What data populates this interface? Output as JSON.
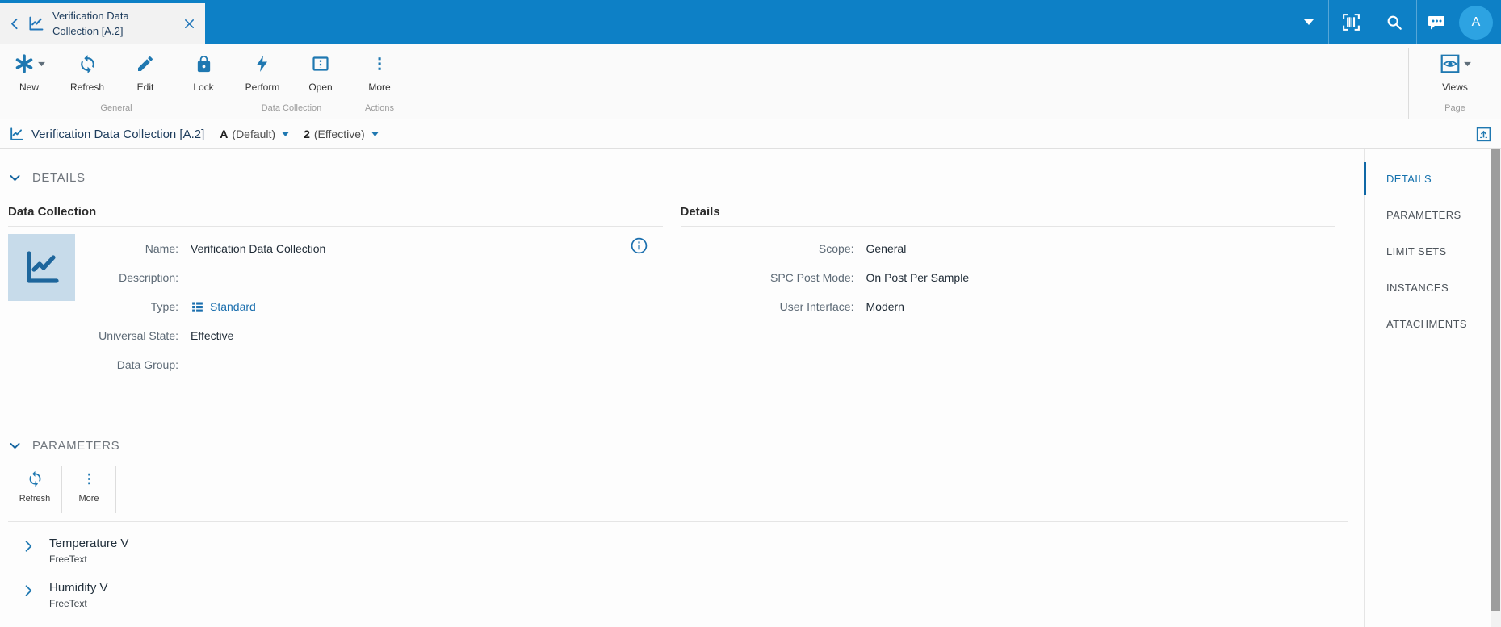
{
  "colors": {
    "topbar_blue": "#0d80c6",
    "avatar_blue": "#2da3e2",
    "icon_blue": "#1f78b1",
    "link_blue": "#1b6fae",
    "nav_active_blue": "#1471ad",
    "tile_background": "#c7dbea"
  },
  "icons": {
    "back": "chevron-left",
    "tab_chart": "line-chart",
    "close": "x-mark",
    "dropdown": "caret-down",
    "barcode": "barcode-scanner",
    "search": "magnifier",
    "chat": "speech-bubble-dots",
    "new": "asterisk",
    "refresh": "sync-arrows",
    "edit": "pencil",
    "lock": "padlock",
    "perform": "lightning-bolt",
    "open": "panel-dashed",
    "more": "vertical-dots",
    "views": "eye-in-box",
    "info": "info-circle",
    "type": "detail-list",
    "expand": "arrow-up-box",
    "item_chevron": "chevron-right",
    "section_chevron": "chevron-down"
  },
  "topbar": {
    "tab_title": "Verification Data Collection [A.2]",
    "avatar_initial": "A"
  },
  "ribbon": {
    "groups": [
      {
        "label": "General",
        "buttons": [
          {
            "label": "New"
          },
          {
            "label": "Refresh"
          },
          {
            "label": "Edit"
          },
          {
            "label": "Lock"
          }
        ]
      },
      {
        "label": "Data Collection",
        "buttons": [
          {
            "label": "Perform"
          },
          {
            "label": "Open"
          }
        ]
      },
      {
        "label": "Actions",
        "buttons": [
          {
            "label": "More"
          }
        ]
      },
      {
        "label": "Page",
        "buttons": [
          {
            "label": "Views"
          }
        ]
      }
    ]
  },
  "breadcrumb": {
    "title": "Verification Data Collection [A.2]",
    "version": "A",
    "version_label": "(Default)",
    "revision": "2",
    "revision_label": "(Effective)"
  },
  "details_section": {
    "header": "DETAILS",
    "data_collection_panel": {
      "title": "Data Collection",
      "fields": [
        {
          "label": "Name:",
          "value": "Verification Data Collection"
        },
        {
          "label": "Description:",
          "value": ""
        },
        {
          "label": "Type:",
          "value": "Standard"
        },
        {
          "label": "Universal State:",
          "value": "Effective"
        },
        {
          "label": "Data Group:",
          "value": ""
        }
      ]
    },
    "details_panel": {
      "title": "Details",
      "fields": [
        {
          "label": "Scope:",
          "value": "General"
        },
        {
          "label": "SPC Post Mode:",
          "value": "On Post Per Sample"
        },
        {
          "label": "User Interface:",
          "value": "Modern"
        }
      ]
    }
  },
  "parameters_section": {
    "header": "PARAMETERS",
    "toolbar": [
      {
        "label": "Refresh"
      },
      {
        "label": "More"
      }
    ],
    "items": [
      {
        "name": "Temperature V",
        "type": "FreeText"
      },
      {
        "name": "Humidity V",
        "type": "FreeText"
      }
    ]
  },
  "side_nav": {
    "items": [
      {
        "label": "DETAILS",
        "active": true
      },
      {
        "label": "PARAMETERS",
        "active": false
      },
      {
        "label": "LIMIT SETS",
        "active": false
      },
      {
        "label": "INSTANCES",
        "active": false
      },
      {
        "label": "ATTACHMENTS",
        "active": false
      }
    ]
  }
}
